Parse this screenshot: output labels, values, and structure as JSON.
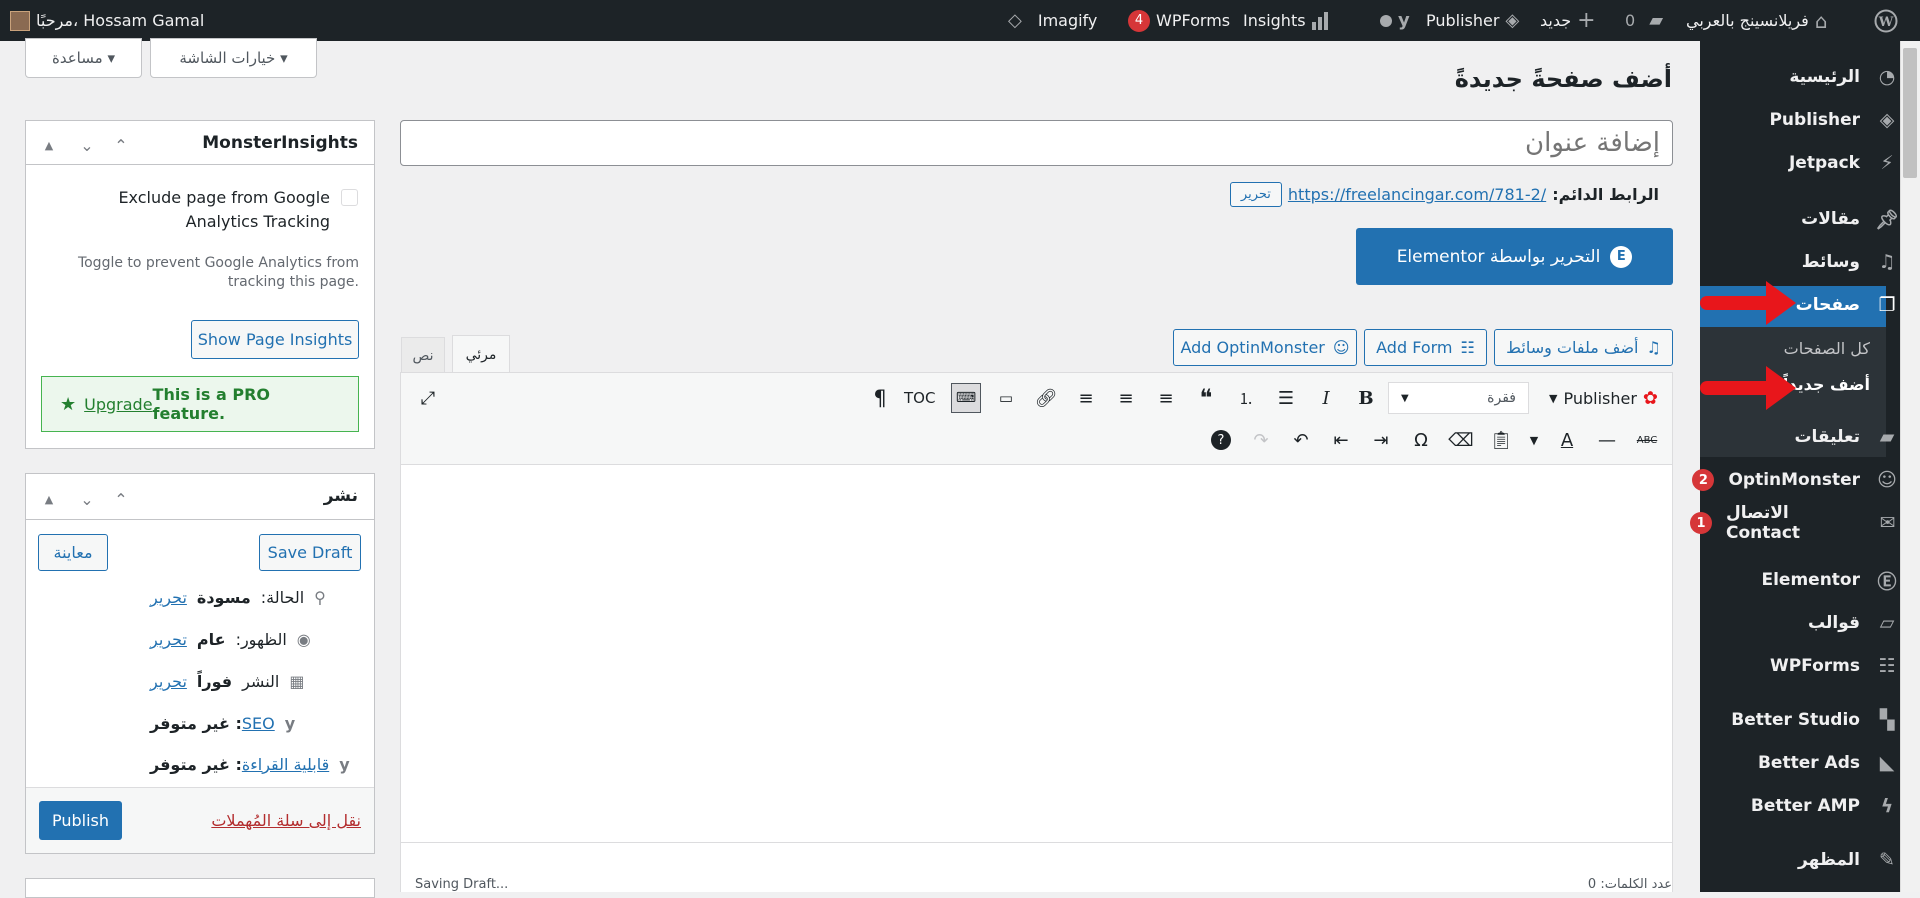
{
  "admin_bar": {
    "site_name": "فريلانسينج بالعربي",
    "comments_count": "0",
    "new_label": "جديد",
    "publisher_label": "Publisher",
    "insights_label": "Insights",
    "wpforms_label": "WPForms",
    "wpforms_badge": "4",
    "imagify_label": "Imagify",
    "greeting": "مرحبًا، Hossam Gamal"
  },
  "sidebar": {
    "items": [
      {
        "label": "الرئيسية",
        "icon": "dashboard-icon"
      },
      {
        "label": "Publisher",
        "icon": "publisher-icon"
      },
      {
        "label": "Jetpack",
        "icon": "jetpack-icon"
      },
      {
        "label": "مقالات",
        "icon": "pin-icon"
      },
      {
        "label": "وسائط",
        "icon": "media-icon"
      },
      {
        "label": "صفحات",
        "icon": "pages-icon"
      },
      {
        "label": "تعليقات",
        "icon": "comment-icon"
      },
      {
        "label": "OptinMonster",
        "icon": "optinmonster-icon",
        "badge": "2"
      },
      {
        "label": "الاتصال Contact",
        "icon": "mail-icon",
        "badge": "1"
      },
      {
        "label": "Elementor",
        "icon": "elementor-icon"
      },
      {
        "label": "قوالب",
        "icon": "folder-icon"
      },
      {
        "label": "WPForms",
        "icon": "wpforms-icon"
      },
      {
        "label": "Better Studio",
        "icon": "betterstudio-icon"
      },
      {
        "label": "Better Ads",
        "icon": "betterads-icon"
      },
      {
        "label": "Better AMP",
        "icon": "betteramp-icon"
      },
      {
        "label": "المظهر",
        "icon": "brush-icon"
      }
    ],
    "submenu": [
      "كل الصفحات",
      "أضف جديداً"
    ]
  },
  "top_buttons": {
    "screen_options": "خيارات الشاشة ▾",
    "help": "مساعدة ▾"
  },
  "page": {
    "heading": "أضف صفحةً جديدةً",
    "title_placeholder": "إضافة عنوان",
    "permalink_label": "الرابط الدائم:",
    "permalink_url": "https://freelancingar.com/781-2/",
    "permalink_edit": "تحرير",
    "elementor_button": "التحرير بواسطة Elementor"
  },
  "editor": {
    "add_media": "أضف ملفات وسائط",
    "add_form": "Add Form",
    "add_optinmonster": "Add OptinMonster",
    "tab_visual": "مرئي",
    "tab_text": "نص",
    "publisher_menu": "Publisher",
    "paragraph_select": "فقرة",
    "toc": "TOC",
    "word_count": "عدد الكلمات: 0",
    "saving": "Saving Draft..."
  },
  "monsterinsights": {
    "title": "MonsterInsights",
    "exclude_label": "Exclude page from Google Analytics Tracking",
    "help": "Toggle to prevent Google Analytics from tracking this page.",
    "show_insights": "Show Page Insights",
    "pro_text": "This is a PRO feature.",
    "upgrade": "Upgrade"
  },
  "publish": {
    "title": "نشر",
    "save_draft": "Save Draft",
    "preview": "معاينة",
    "status_label": "الحالة:",
    "status_value": "مسودة",
    "visibility_label": "الظهور:",
    "visibility_value": "عام",
    "schedule_label": "النشر",
    "schedule_value": "فوراً",
    "edit": "تحرير",
    "seo_link": "SEO",
    "seo_value": ": غير متوفر",
    "readability_link": "قابلية القراءة",
    "readability_value": ": غير متوفر",
    "trash": "نقل إلى سلة المُهملات",
    "publish_btn": "Publish"
  },
  "colors": {
    "accent": "#2271b1",
    "adminbar": "#1d2327",
    "danger": "#d63638",
    "annotation_arrow": "#e8161b"
  }
}
